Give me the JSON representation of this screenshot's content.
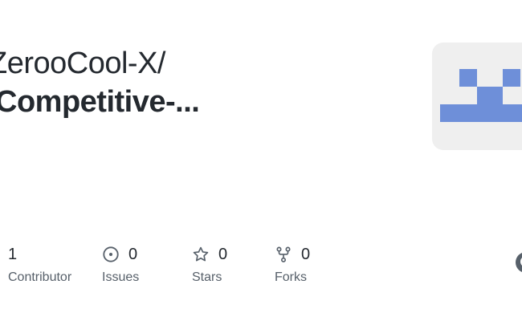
{
  "repo": {
    "owner_prefix": "ZerooCool-X/",
    "name_visible": "Competitive-",
    "name_ellipsis": "..."
  },
  "avatar": {
    "icon": "identicon",
    "background_color": "#efefef",
    "pattern_color": "#6e8fd9"
  },
  "stats": {
    "contributors": {
      "count": "1",
      "label": "Contributor",
      "icon": "people-icon"
    },
    "issues": {
      "count": "0",
      "label": "Issues",
      "icon": "issue-opened-icon"
    },
    "stars": {
      "count": "0",
      "label": "Stars",
      "icon": "star-icon"
    },
    "forks": {
      "count": "0",
      "label": "Forks",
      "icon": "repo-forked-icon"
    }
  },
  "logo": {
    "icon": "github-mark-icon"
  },
  "colors": {
    "text_primary": "#24292f",
    "text_secondary": "#57606a",
    "icon_gray": "#57606a"
  }
}
